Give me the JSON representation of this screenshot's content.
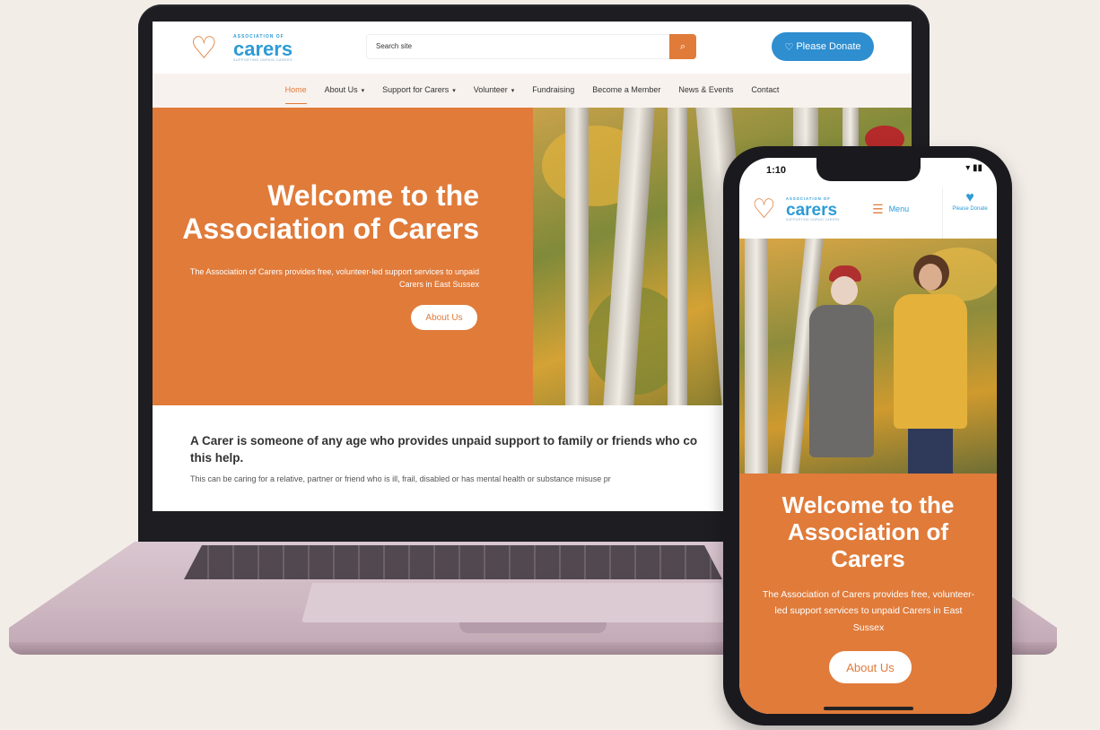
{
  "site": {
    "logo": {
      "assoc": "ASSOCIATION OF",
      "word": "carers",
      "tagline": "SUPPORTING UNPAID CARERS"
    }
  },
  "laptop": {
    "search": {
      "placeholder": "Search site",
      "icon": "search-icon"
    },
    "donate_label": "Please Donate",
    "nav": [
      {
        "label": "Home",
        "active": true,
        "has_dropdown": false
      },
      {
        "label": "About Us",
        "has_dropdown": true
      },
      {
        "label": "Support for Carers",
        "has_dropdown": true
      },
      {
        "label": "Volunteer",
        "has_dropdown": true
      },
      {
        "label": "Fundraising",
        "has_dropdown": false
      },
      {
        "label": "Become a Member",
        "has_dropdown": false
      },
      {
        "label": "News & Events",
        "has_dropdown": false
      },
      {
        "label": "Contact",
        "has_dropdown": false
      }
    ],
    "hero": {
      "title": "Welcome to the Association of Carers",
      "subtitle": "The Association of Carers provides free, volunteer-led support services to unpaid Carers in East Sussex",
      "button": "About Us"
    },
    "intro": {
      "heading": "A Carer is someone of any age who provides unpaid support to family or friends who co\nthis help.",
      "text": "This can be caring for a relative, partner or friend who is ill, frail, disabled or has mental health or substance misuse pr"
    }
  },
  "phone": {
    "status_time": "1:10",
    "menu_label": "Menu",
    "donate_label": "Please Donate",
    "hero": {
      "title": "Welcome to the\nAssociation of\nCarers",
      "subtitle": "The Association of Carers provides free, volunteer-led support services to unpaid Carers in East Sussex",
      "button": "About Us"
    }
  },
  "colors": {
    "brand_orange": "#e07b3a",
    "brand_blue": "#2e8ed0",
    "background": "#f3ede8"
  }
}
